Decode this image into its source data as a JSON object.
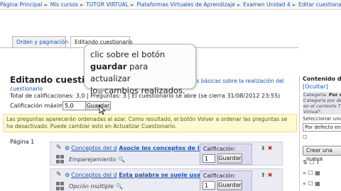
{
  "breadcrumb": [
    "Página Principal",
    "Mis cursos",
    "TUTOR VIRTUAL",
    "Plataformas Virtuales de Aprendizaje",
    "Examen Unidad 4",
    "Editar cuestionario"
  ],
  "breadcrumb_sep": "►",
  "tabs": [
    "Orden y paginación",
    "Editando cuestionario"
  ],
  "page": {
    "title": "Editando cuestionar",
    "help_link_1": "as básicas sobre la realización del",
    "help_link_2": "cuestionario",
    "totals": "Total de calificaciones: 3,0 | Preguntas: 3 | El cuestionario se abre (se cierra 31/08/2012 23:55)",
    "max_grade_label": "Calificación máxima",
    "max_grade_value": "5,0",
    "save_label": "Guardar"
  },
  "notice": "Las preguntas aparecerán ordenadas al azar. Como resultado, el botón Volver a ordenar las preguntas se ha desactivado. Puede cambiar esto en Actualizar Cuestionario.",
  "pagina": "Página 1",
  "questions": [
    {
      "number": "1",
      "link_prefix": "Conceptos del d",
      "link_title": "Asocie los conceptos de l...",
      "type": "Emparejamiento",
      "grade_label": "Calificación:",
      "grade_value": "1",
      "save_label": "Guardar"
    },
    {
      "number": "2",
      "link_prefix": "Conceptos del d",
      "link_title": "Esta palabra se suele usa...",
      "type": "Opción múltiple",
      "grade_label": "Calificación:",
      "grade_value": "1",
      "save_label": "Guardar"
    }
  ],
  "side_panel": {
    "heading": "Contenido de",
    "hide": "[Ocultar]",
    "category_label": "Categoría:",
    "category_value": "Por c",
    "category_desc_1": "Categoría por de",
    "category_desc_2": "en el contexto T",
    "category_desc_3": "Virtual\".",
    "select_label": "Seleccionar una c",
    "select_value": "Por defecto en T",
    "create_new": "Crear una nueva"
  },
  "tooltip": {
    "line1": "clic sobre el botón",
    "line2_bold": "guardar",
    "line2_rest": " para actualizar",
    "line3": "los cambios realizados."
  },
  "colors": {
    "link": "#1a55b5",
    "notice_bg": "#fdfad2",
    "slot_bg": "#ebebf3",
    "grade_box_bg": "#dcdcf0"
  }
}
